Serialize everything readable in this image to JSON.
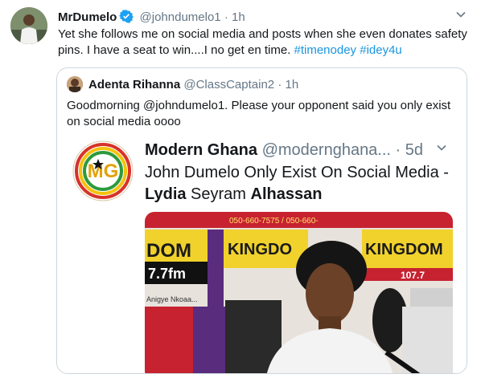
{
  "tweet": {
    "author_name": "MrDumelo",
    "handle": "@johndumelo1",
    "separator": "·",
    "time": "1h",
    "text_before": "Yet she follows me on social media and posts when she even donates safety pins. I have a seat to win....I no get en time. ",
    "hashtag1": "#timenodey",
    "hashtag2": "#idey4u",
    "icons": {
      "verified": "verified-badge-icon",
      "caret": "chevron-down-icon"
    },
    "colors": {
      "link": "#1b95e0",
      "verified": "#1da1f2"
    }
  },
  "quote": {
    "author_name": "Adenta Rihanna",
    "handle": "@ClassCaptain2",
    "separator": "·",
    "time": "1h",
    "text": "Goodmorning @johndumelo1. Please your opponent said you only exist on social media oooo"
  },
  "card": {
    "source_name": "Modern Ghana",
    "source_handle": "@modernghana...",
    "separator": "·",
    "time": "5d",
    "title_part1": "John Dumelo Only Exist On Social Media - ",
    "title_name1": "Lydia",
    "title_name2": " Seyram ",
    "title_name3": "Alhassan",
    "logo_text": "MG",
    "photo_texts": {
      "phone": "050-660-7575 / 050-660-",
      "banner_left": "DOM",
      "freq_left": "7.7fm",
      "banner_mid": "KINGDO",
      "banner_right": "KINGDOM",
      "freq_right": "107.7",
      "caption": "Anigye Nkoaa..."
    }
  }
}
